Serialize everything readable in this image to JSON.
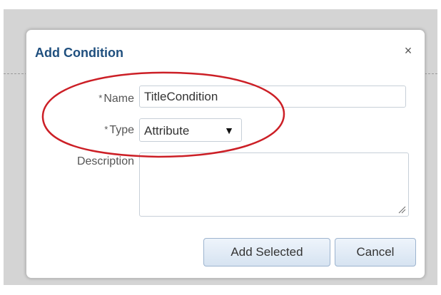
{
  "dialog": {
    "title": "Add Condition",
    "close_label": "×"
  },
  "form": {
    "name": {
      "required_marker": "*",
      "label": "Name",
      "value": "TitleCondition"
    },
    "type": {
      "required_marker": "*",
      "label": "Type",
      "value": "Attribute",
      "arrow": "▼"
    },
    "description": {
      "label": "Description",
      "value": ""
    }
  },
  "buttons": {
    "add_selected": "Add Selected",
    "cancel": "Cancel"
  },
  "colors": {
    "title": "#1f4f7e",
    "annotation": "#cc1f26",
    "button_border": "#9db4cf"
  }
}
